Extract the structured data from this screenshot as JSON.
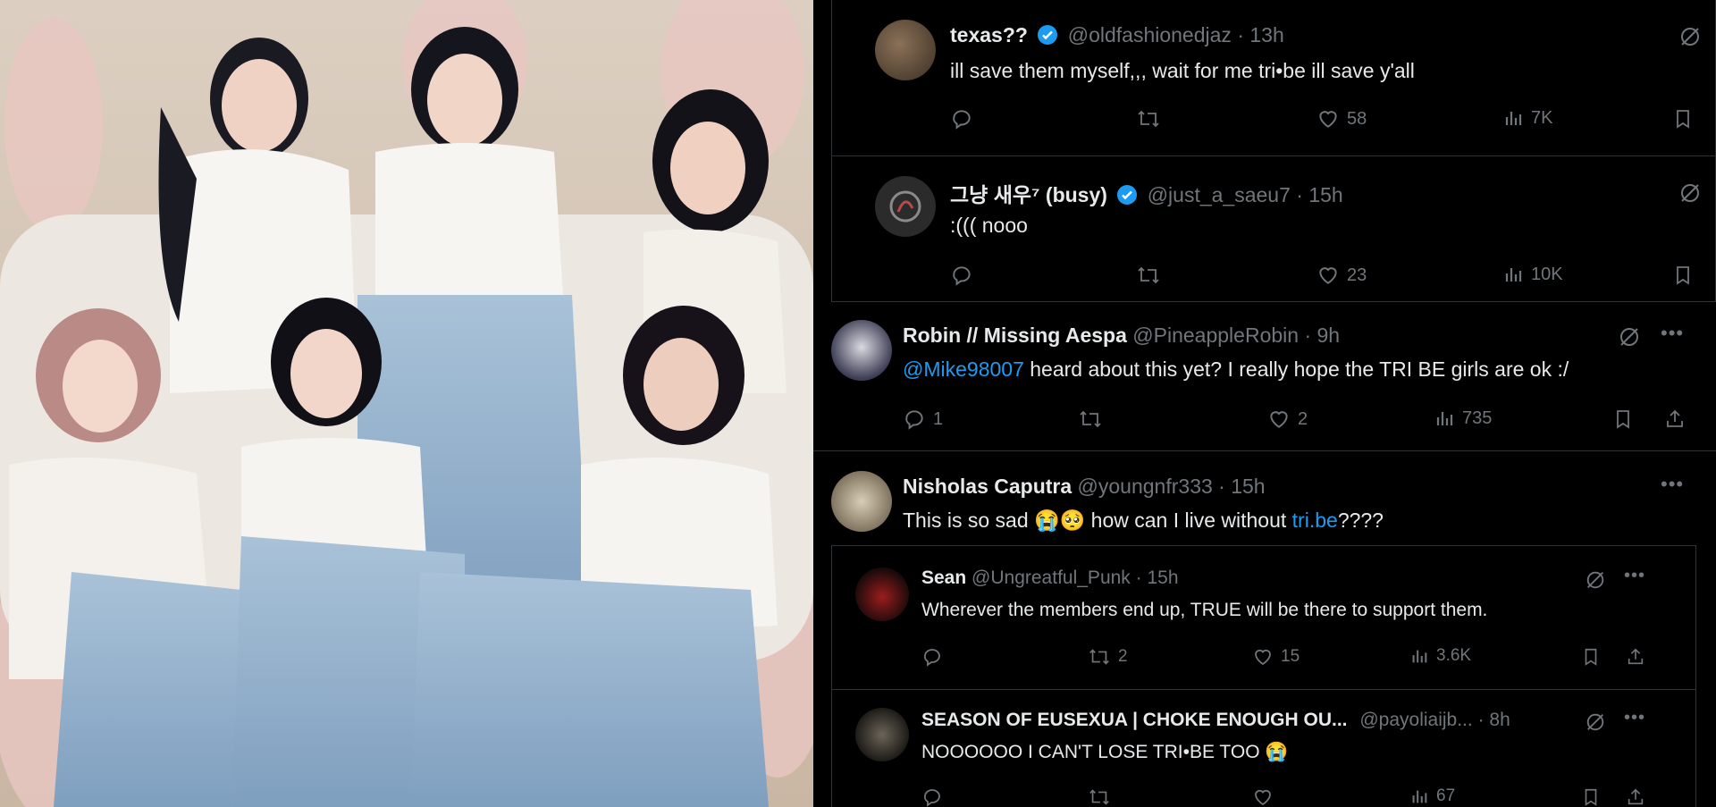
{
  "tweets": [
    {
      "name": "texas??",
      "handle": "@oldfashionedjaz",
      "time": "· 13h",
      "text": "ill save them myself,,, wait for me tri•be ill save y'all",
      "replies": "",
      "retweets": "",
      "likes": "58",
      "views": "7K"
    },
    {
      "name": "그냥 새우⁷ (busy)",
      "handle": "@just_a_saeu7",
      "time": "· 15h",
      "text": ":((( nooo",
      "replies": "",
      "retweets": "",
      "likes": "23",
      "views": "10K"
    },
    {
      "name": "Robin // Missing Aespa",
      "handle": "@PineappleRobin",
      "time": "· 9h",
      "mention": "@Mike98007",
      "text": " heard about this yet? I really hope the TRI BE girls are ok :/",
      "replies": "1",
      "retweets": "",
      "likes": "2",
      "views": "735"
    },
    {
      "name": "Nisholas Caputra",
      "handle": "@youngnfr333",
      "time": "· 15h",
      "text_before": "This is so sad 😭🥺 how can I live without ",
      "link": "tri.be",
      "text_after": "????"
    },
    {
      "name": "Sean",
      "handle": "@Ungreatful_Punk",
      "time": "· 15h",
      "text": "Wherever the members end up, TRUE will be there to support them.",
      "replies": "",
      "retweets": "2",
      "likes": "15",
      "views": "3.6K"
    },
    {
      "name": "SEASON OF EUSEXUA | CHOKE ENOUGH OU...",
      "handle": "@payoliaijb...",
      "time": "· 8h",
      "text": "NOOOOOO I CAN'T LOSE TRI•BE TOO 😭",
      "replies": "",
      "retweets": "",
      "likes": "",
      "views": "67"
    }
  ],
  "icons": {
    "verified": "verified-badge-icon",
    "grok": "grok-icon",
    "more": "more-icon",
    "reply": "reply-icon",
    "retweet": "retweet-icon",
    "like": "like-icon",
    "views": "views-icon",
    "bookmark": "bookmark-icon",
    "share": "share-icon"
  },
  "colors": {
    "accent": "#1d9bf0",
    "muted": "#71767b",
    "text": "#e7e9ea",
    "background": "#000000"
  }
}
